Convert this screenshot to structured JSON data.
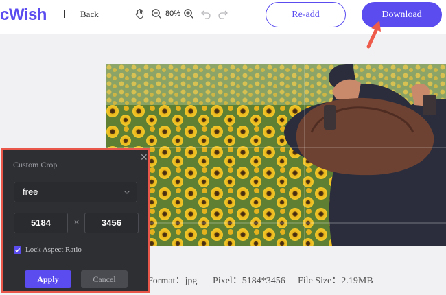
{
  "header": {
    "logo": "cWish",
    "back_label": "Back",
    "zoom": "80%",
    "readd_label": "Re-add",
    "download_label": "Download"
  },
  "tools": {
    "pan": "hand-icon",
    "zoom_out": "zoom-out-icon",
    "zoom_in": "zoom-in-icon",
    "undo": "undo-icon",
    "redo": "redo-icon"
  },
  "image_info": {
    "format": "Format：jpg",
    "pixel": "Pixel：5184*3456",
    "file_size": "File Size：2.19MB"
  },
  "crop_panel": {
    "title": "Custom Crop",
    "mode": "free",
    "width": "5184",
    "times": "×",
    "height": "3456",
    "lock_label": "Lock Aspect Ratio",
    "lock_checked": true,
    "apply_label": "Apply",
    "cancel_label": "Cancel"
  },
  "colors": {
    "accent": "#5b4cf0",
    "highlight": "#e8574a",
    "panel_bg": "#2e2f33"
  }
}
